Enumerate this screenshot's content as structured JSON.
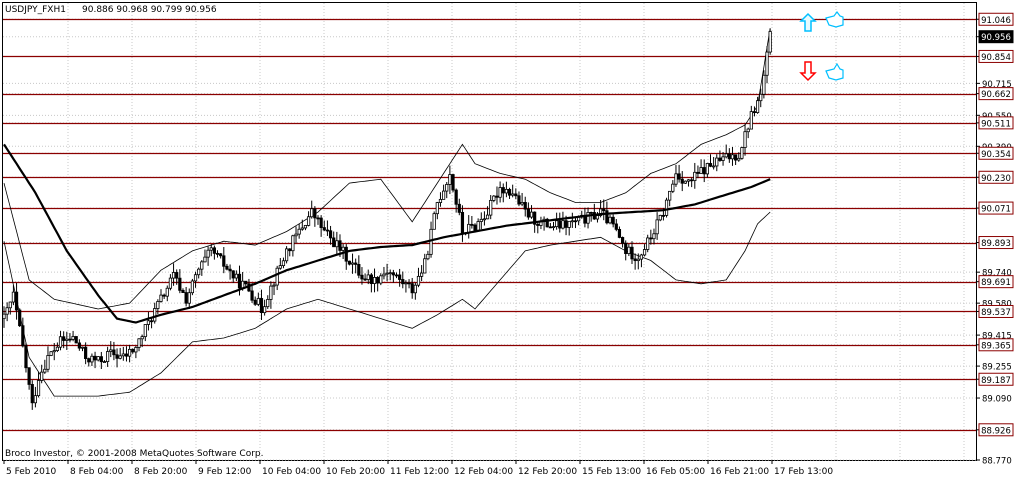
{
  "window": {
    "symbol_label": "USDJPY_FXH1",
    "ohlc_label": "90.886 90.968 90.799 90.956",
    "copyright": "Broco Investor, © 2001-2008 MetaQuotes Software Corp."
  },
  "colors": {
    "background": "#ffffff",
    "grid": "#c8c8c8",
    "level_line": "#8b0000",
    "candle": "#000000",
    "moving_average": "#000000",
    "band": "#000000",
    "arrow_up": "#00bfff",
    "arrow_down": "#ff0000",
    "hand_icon": "#00bfff"
  },
  "chart_data": {
    "type": "candlestick",
    "ylim": [
      88.77,
      91.13
    ],
    "price_ticks": [
      "91.046",
      "90.956",
      "90.854",
      "90.715",
      "90.662",
      "90.550",
      "90.511",
      "90.390",
      "90.354",
      "90.230",
      "90.071",
      "89.893",
      "89.740",
      "89.691",
      "89.580",
      "89.537",
      "89.415",
      "89.365",
      "89.255",
      "89.187",
      "89.090",
      "88.926",
      "88.770"
    ],
    "levels": [
      "91.046",
      "90.854",
      "90.662",
      "90.511",
      "90.354",
      "90.230",
      "90.071",
      "89.893",
      "89.691",
      "89.537",
      "89.365",
      "89.187",
      "88.926"
    ],
    "current_price": "90.956",
    "time_labels": [
      "5 Feb 2010",
      "8 Feb 04:00",
      "8 Feb 20:00",
      "9 Feb 12:00",
      "10 Feb 04:00",
      "10 Feb 20:00",
      "11 Feb 12:00",
      "12 Feb 04:00",
      "12 Feb 20:00",
      "15 Feb 13:00",
      "16 Feb 05:00",
      "16 Feb 21:00",
      "17 Feb 13:00"
    ],
    "close_anchors": [
      [
        0,
        89.5
      ],
      [
        3,
        89.62
      ],
      [
        6,
        89.35
      ],
      [
        9,
        89.05
      ],
      [
        11,
        89.2
      ],
      [
        14,
        89.3
      ],
      [
        18,
        89.38
      ],
      [
        22,
        89.4
      ],
      [
        26,
        89.3
      ],
      [
        30,
        89.28
      ],
      [
        34,
        89.32
      ],
      [
        38,
        89.3
      ],
      [
        42,
        89.35
      ],
      [
        46,
        89.48
      ],
      [
        50,
        89.6
      ],
      [
        54,
        89.72
      ],
      [
        58,
        89.6
      ],
      [
        62,
        89.75
      ],
      [
        66,
        89.85
      ],
      [
        70,
        89.78
      ],
      [
        74,
        89.7
      ],
      [
        78,
        89.65
      ],
      [
        82,
        89.55
      ],
      [
        86,
        89.7
      ],
      [
        90,
        89.85
      ],
      [
        94,
        89.95
      ],
      [
        98,
        90.05
      ],
      [
        102,
        89.95
      ],
      [
        106,
        89.88
      ],
      [
        110,
        89.8
      ],
      [
        114,
        89.72
      ],
      [
        118,
        89.7
      ],
      [
        122,
        89.75
      ],
      [
        126,
        89.7
      ],
      [
        130,
        89.65
      ],
      [
        134,
        89.78
      ],
      [
        138,
        90.1
      ],
      [
        142,
        90.25
      ],
      [
        146,
        89.95
      ],
      [
        150,
        89.98
      ],
      [
        154,
        90.05
      ],
      [
        158,
        90.18
      ],
      [
        162,
        90.15
      ],
      [
        166,
        90.05
      ],
      [
        170,
        90.0
      ],
      [
        174,
        89.98
      ],
      [
        178,
        89.98
      ],
      [
        182,
        90.0
      ],
      [
        186,
        90.02
      ],
      [
        190,
        90.05
      ],
      [
        194,
        89.98
      ],
      [
        198,
        89.85
      ],
      [
        202,
        89.82
      ],
      [
        206,
        89.92
      ],
      [
        210,
        90.05
      ],
      [
        214,
        90.25
      ],
      [
        218,
        90.2
      ],
      [
        222,
        90.26
      ],
      [
        226,
        90.3
      ],
      [
        230,
        90.33
      ],
      [
        234,
        90.35
      ],
      [
        238,
        90.55
      ],
      [
        241,
        90.65
      ],
      [
        244,
        90.956
      ]
    ],
    "ma_anchors": [
      [
        0,
        90.4
      ],
      [
        10,
        90.15
      ],
      [
        20,
        89.85
      ],
      [
        30,
        89.62
      ],
      [
        36,
        89.5
      ],
      [
        42,
        89.48
      ],
      [
        50,
        89.52
      ],
      [
        60,
        89.56
      ],
      [
        70,
        89.62
      ],
      [
        80,
        89.68
      ],
      [
        90,
        89.75
      ],
      [
        100,
        89.8
      ],
      [
        110,
        89.85
      ],
      [
        120,
        89.87
      ],
      [
        130,
        89.88
      ],
      [
        140,
        89.92
      ],
      [
        150,
        89.95
      ],
      [
        160,
        89.98
      ],
      [
        170,
        90.0
      ],
      [
        180,
        90.02
      ],
      [
        190,
        90.04
      ],
      [
        200,
        90.05
      ],
      [
        210,
        90.06
      ],
      [
        220,
        90.09
      ],
      [
        230,
        90.14
      ],
      [
        238,
        90.18
      ],
      [
        244,
        90.22
      ]
    ],
    "upper_band_anchors": [
      [
        0,
        90.2
      ],
      [
        8,
        89.7
      ],
      [
        16,
        89.6
      ],
      [
        30,
        89.55
      ],
      [
        40,
        89.58
      ],
      [
        50,
        89.75
      ],
      [
        60,
        89.85
      ],
      [
        70,
        89.9
      ],
      [
        80,
        89.88
      ],
      [
        90,
        89.95
      ],
      [
        100,
        90.05
      ],
      [
        110,
        90.2
      ],
      [
        120,
        90.22
      ],
      [
        130,
        90.0
      ],
      [
        138,
        90.2
      ],
      [
        146,
        90.4
      ],
      [
        150,
        90.3
      ],
      [
        158,
        90.25
      ],
      [
        166,
        90.22
      ],
      [
        174,
        90.15
      ],
      [
        182,
        90.1
      ],
      [
        190,
        90.1
      ],
      [
        198,
        90.15
      ],
      [
        206,
        90.25
      ],
      [
        214,
        90.3
      ],
      [
        222,
        90.4
      ],
      [
        230,
        90.45
      ],
      [
        236,
        90.5
      ],
      [
        240,
        90.6
      ],
      [
        244,
        91.0
      ]
    ],
    "lower_band_anchors": [
      [
        0,
        89.9
      ],
      [
        8,
        89.3
      ],
      [
        16,
        89.1
      ],
      [
        30,
        89.1
      ],
      [
        40,
        89.12
      ],
      [
        50,
        89.22
      ],
      [
        60,
        89.38
      ],
      [
        70,
        89.4
      ],
      [
        80,
        89.45
      ],
      [
        90,
        89.55
      ],
      [
        100,
        89.6
      ],
      [
        110,
        89.55
      ],
      [
        120,
        89.5
      ],
      [
        130,
        89.45
      ],
      [
        138,
        89.52
      ],
      [
        146,
        89.6
      ],
      [
        150,
        89.55
      ],
      [
        158,
        89.7
      ],
      [
        166,
        89.85
      ],
      [
        174,
        89.88
      ],
      [
        182,
        89.9
      ],
      [
        190,
        89.92
      ],
      [
        198,
        89.85
      ],
      [
        206,
        89.8
      ],
      [
        214,
        89.7
      ],
      [
        222,
        89.68
      ],
      [
        230,
        89.7
      ],
      [
        236,
        89.85
      ],
      [
        240,
        89.99
      ],
      [
        244,
        90.05
      ]
    ]
  }
}
